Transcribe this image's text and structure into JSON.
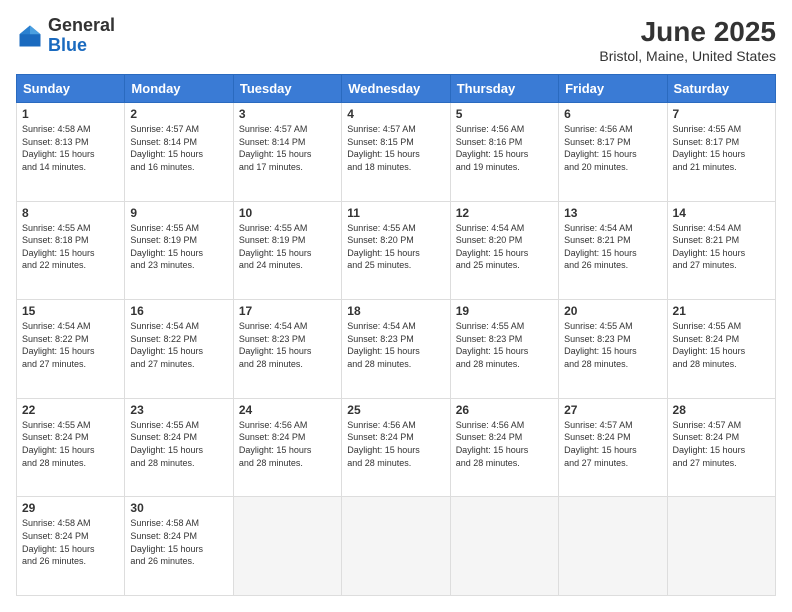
{
  "header": {
    "logo_general": "General",
    "logo_blue": "Blue",
    "month_year": "June 2025",
    "location": "Bristol, Maine, United States"
  },
  "days_of_week": [
    "Sunday",
    "Monday",
    "Tuesday",
    "Wednesday",
    "Thursday",
    "Friday",
    "Saturday"
  ],
  "weeks": [
    [
      {
        "day": "1",
        "sunrise": "4:58 AM",
        "sunset": "8:13 PM",
        "daylight": "15 hours and 14 minutes."
      },
      {
        "day": "2",
        "sunrise": "4:57 AM",
        "sunset": "8:14 PM",
        "daylight": "15 hours and 16 minutes."
      },
      {
        "day": "3",
        "sunrise": "4:57 AM",
        "sunset": "8:14 PM",
        "daylight": "15 hours and 17 minutes."
      },
      {
        "day": "4",
        "sunrise": "4:57 AM",
        "sunset": "8:15 PM",
        "daylight": "15 hours and 18 minutes."
      },
      {
        "day": "5",
        "sunrise": "4:56 AM",
        "sunset": "8:16 PM",
        "daylight": "15 hours and 19 minutes."
      },
      {
        "day": "6",
        "sunrise": "4:56 AM",
        "sunset": "8:17 PM",
        "daylight": "15 hours and 20 minutes."
      },
      {
        "day": "7",
        "sunrise": "4:55 AM",
        "sunset": "8:17 PM",
        "daylight": "15 hours and 21 minutes."
      }
    ],
    [
      {
        "day": "8",
        "sunrise": "4:55 AM",
        "sunset": "8:18 PM",
        "daylight": "15 hours and 22 minutes."
      },
      {
        "day": "9",
        "sunrise": "4:55 AM",
        "sunset": "8:19 PM",
        "daylight": "15 hours and 23 minutes."
      },
      {
        "day": "10",
        "sunrise": "4:55 AM",
        "sunset": "8:19 PM",
        "daylight": "15 hours and 24 minutes."
      },
      {
        "day": "11",
        "sunrise": "4:55 AM",
        "sunset": "8:20 PM",
        "daylight": "15 hours and 25 minutes."
      },
      {
        "day": "12",
        "sunrise": "4:54 AM",
        "sunset": "8:20 PM",
        "daylight": "15 hours and 25 minutes."
      },
      {
        "day": "13",
        "sunrise": "4:54 AM",
        "sunset": "8:21 PM",
        "daylight": "15 hours and 26 minutes."
      },
      {
        "day": "14",
        "sunrise": "4:54 AM",
        "sunset": "8:21 PM",
        "daylight": "15 hours and 27 minutes."
      }
    ],
    [
      {
        "day": "15",
        "sunrise": "4:54 AM",
        "sunset": "8:22 PM",
        "daylight": "15 hours and 27 minutes."
      },
      {
        "day": "16",
        "sunrise": "4:54 AM",
        "sunset": "8:22 PM",
        "daylight": "15 hours and 27 minutes."
      },
      {
        "day": "17",
        "sunrise": "4:54 AM",
        "sunset": "8:23 PM",
        "daylight": "15 hours and 28 minutes."
      },
      {
        "day": "18",
        "sunrise": "4:54 AM",
        "sunset": "8:23 PM",
        "daylight": "15 hours and 28 minutes."
      },
      {
        "day": "19",
        "sunrise": "4:55 AM",
        "sunset": "8:23 PM",
        "daylight": "15 hours and 28 minutes."
      },
      {
        "day": "20",
        "sunrise": "4:55 AM",
        "sunset": "8:23 PM",
        "daylight": "15 hours and 28 minutes."
      },
      {
        "day": "21",
        "sunrise": "4:55 AM",
        "sunset": "8:24 PM",
        "daylight": "15 hours and 28 minutes."
      }
    ],
    [
      {
        "day": "22",
        "sunrise": "4:55 AM",
        "sunset": "8:24 PM",
        "daylight": "15 hours and 28 minutes."
      },
      {
        "day": "23",
        "sunrise": "4:55 AM",
        "sunset": "8:24 PM",
        "daylight": "15 hours and 28 minutes."
      },
      {
        "day": "24",
        "sunrise": "4:56 AM",
        "sunset": "8:24 PM",
        "daylight": "15 hours and 28 minutes."
      },
      {
        "day": "25",
        "sunrise": "4:56 AM",
        "sunset": "8:24 PM",
        "daylight": "15 hours and 28 minutes."
      },
      {
        "day": "26",
        "sunrise": "4:56 AM",
        "sunset": "8:24 PM",
        "daylight": "15 hours and 28 minutes."
      },
      {
        "day": "27",
        "sunrise": "4:57 AM",
        "sunset": "8:24 PM",
        "daylight": "15 hours and 27 minutes."
      },
      {
        "day": "28",
        "sunrise": "4:57 AM",
        "sunset": "8:24 PM",
        "daylight": "15 hours and 27 minutes."
      }
    ],
    [
      {
        "day": "29",
        "sunrise": "4:58 AM",
        "sunset": "8:24 PM",
        "daylight": "15 hours and 26 minutes."
      },
      {
        "day": "30",
        "sunrise": "4:58 AM",
        "sunset": "8:24 PM",
        "daylight": "15 hours and 26 minutes."
      },
      null,
      null,
      null,
      null,
      null
    ]
  ]
}
